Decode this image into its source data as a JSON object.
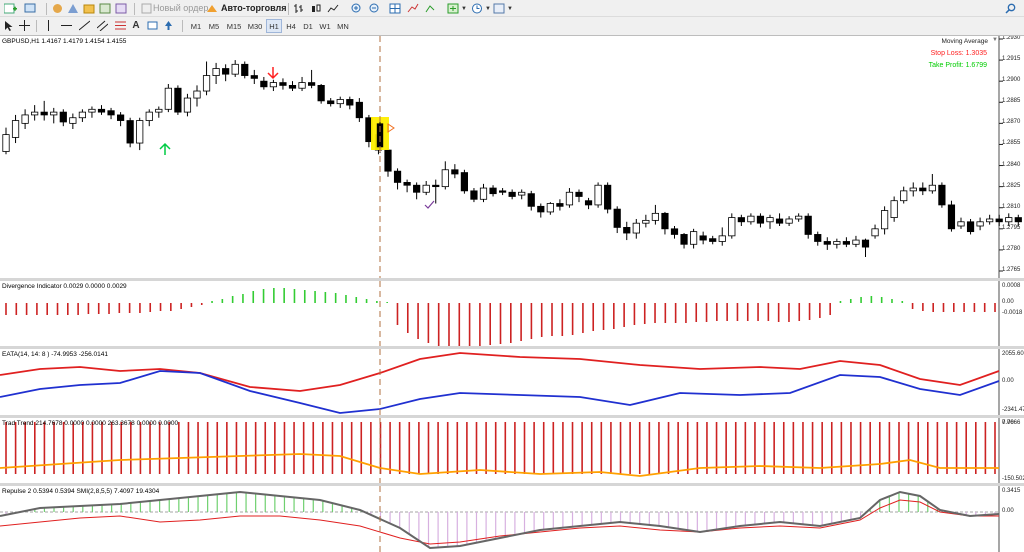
{
  "toolbar": {
    "new_order_label": "Новый ордер",
    "autotrading_label": "Авто-торговля",
    "timeframes": [
      "M1",
      "M5",
      "M15",
      "M30",
      "H1",
      "H4",
      "D1",
      "W1",
      "MN"
    ],
    "active_timeframe": "H1"
  },
  "main": {
    "label": "GBPUSD,H1  1.4167 1.4179 1.4154 1.4155",
    "indicator_name": "Moving Average",
    "stop_loss": "Stop Loss: 1.3035",
    "take_profit": "Take Profit: 1.6799",
    "y_ticks": [
      "1.2930",
      "1.2915",
      "1.2900",
      "1.2885",
      "1.2870",
      "1.2855",
      "1.2840",
      "1.2825",
      "1.2810",
      "1.2795",
      "1.2780",
      "1.2765"
    ],
    "colors": {
      "stop_loss": "#ff2020",
      "take_profit": "#00cc00",
      "highlight": "#ffee00",
      "up_arrow": "#00cc44",
      "down_arrow": "#ff2020"
    }
  },
  "divergence": {
    "label": "Divergence Indicator 0.0029 0.0000 0.0029",
    "y_ticks": [
      "0.0008",
      "0.00",
      "-0.0018"
    ]
  },
  "eata": {
    "label": "EATA(14, 14: 8 ) -74.9953 -256.0141",
    "y_ticks": [
      "2055.6055",
      "0.00",
      "-2341.47"
    ]
  },
  "trend": {
    "label": "Trad Trend 214.7678 0.0000 0.0000 263.3678 0.0000 0.0000",
    "y_ticks": [
      "7.7666",
      "0.00",
      "-150.502"
    ]
  },
  "repulse": {
    "label": "Repulse 2 0.5394 0.5394  SMI(2,8,5,5) 7.4097 19.4304",
    "y_ticks": [
      "0.3415",
      "0.00"
    ]
  }
}
